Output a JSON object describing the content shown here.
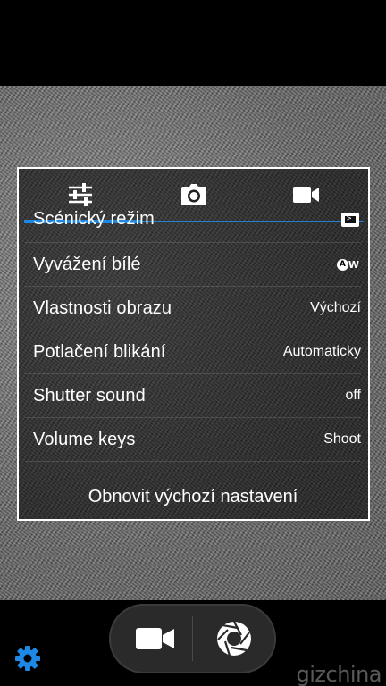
{
  "tabs": [
    {
      "icon": "sliders-icon"
    },
    {
      "icon": "camera-icon"
    },
    {
      "icon": "video-camera-icon"
    }
  ],
  "settings": [
    {
      "label": "Scénický režim",
      "value_icon": "scene-mode-icon"
    },
    {
      "label": "Vyvážení bílé",
      "value_icon": "auto-white-balance-icon",
      "value_icon_text": "AW"
    },
    {
      "label": "Vlastnosti obrazu",
      "value": "Výchozí"
    },
    {
      "label": "Potlačení blikání",
      "value": "Automaticky"
    },
    {
      "label": "Shutter sound",
      "value": "off"
    },
    {
      "label": "Volume keys",
      "value": "Shoot"
    }
  ],
  "reset_label": "Obnovit výchozí nastavení",
  "watermark": {
    "text": "gizchina"
  },
  "colors": {
    "accent": "#1e88e5",
    "gear": "#1e88e5"
  }
}
